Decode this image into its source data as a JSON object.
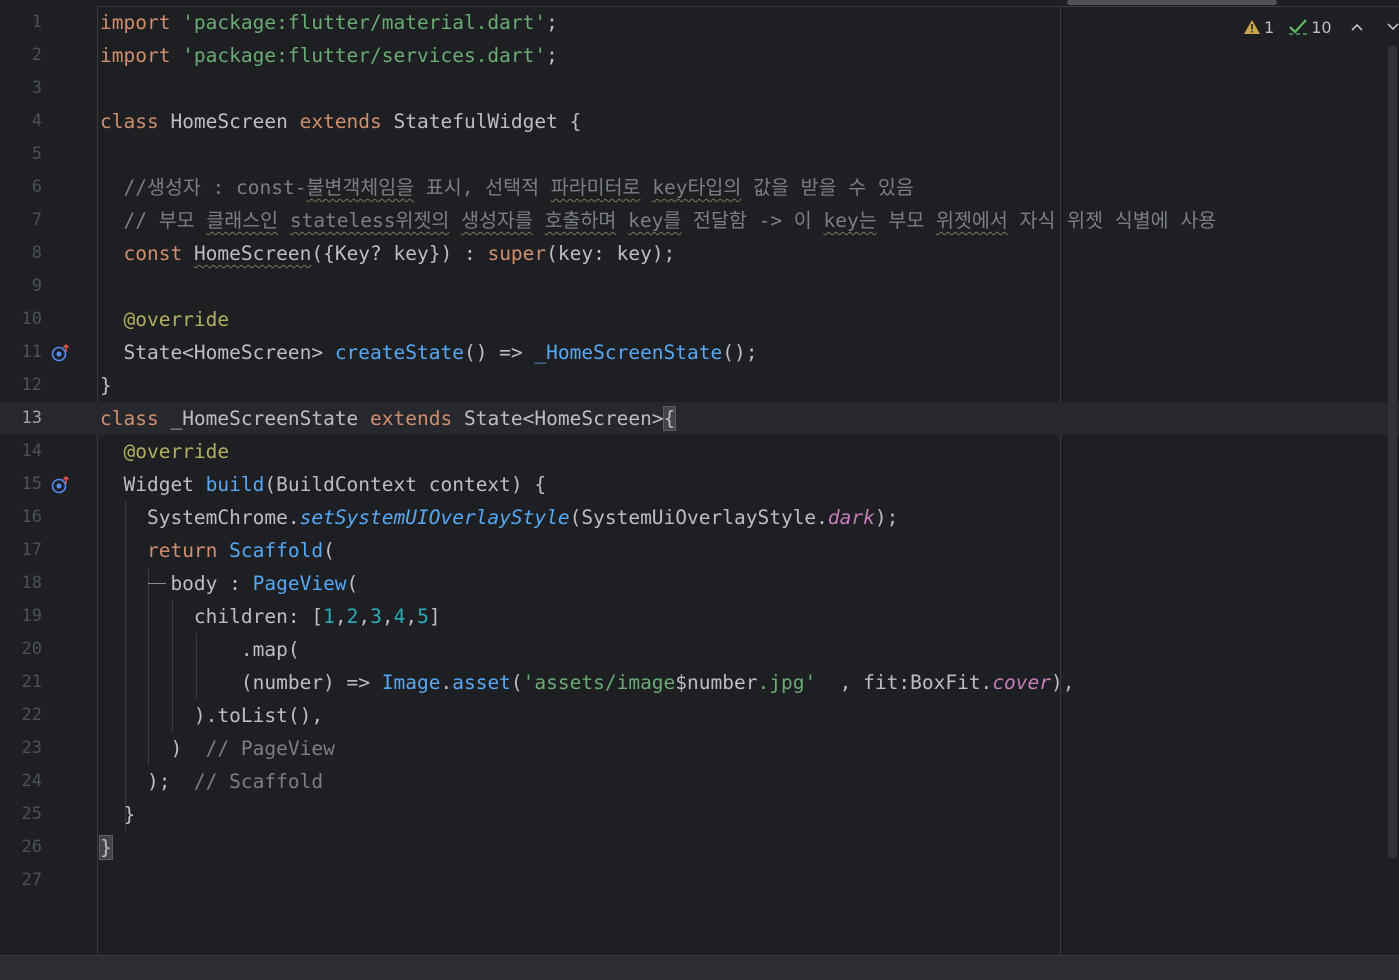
{
  "inspections": {
    "warning_icon": "warning-icon",
    "warning_count": "1",
    "check_icon": "check-icon",
    "check_count": "10",
    "prev_icon": "chevron-up-icon",
    "next_icon": "chevron-down-icon"
  },
  "colors": {
    "keyword": "#cf8e6d",
    "string": "#6aab73",
    "number": "#2aacb8",
    "function": "#56a8f5",
    "property": "#c77dbb",
    "comment": "#7a7e85",
    "annotation": "#b3ae60",
    "background": "#1e1f22"
  },
  "lines": [
    {
      "n": "1",
      "segs": [
        {
          "t": "import ",
          "c": "kw"
        },
        {
          "t": "'package:flutter/material.dart'",
          "c": "str"
        },
        {
          "t": ";"
        }
      ]
    },
    {
      "n": "2",
      "segs": [
        {
          "t": "import ",
          "c": "kw"
        },
        {
          "t": "'package:flutter/services.dart'",
          "c": "str"
        },
        {
          "t": ";"
        }
      ]
    },
    {
      "n": "3",
      "segs": []
    },
    {
      "n": "4",
      "segs": [
        {
          "t": "class ",
          "c": "kw"
        },
        {
          "t": "HomeScreen "
        },
        {
          "t": "extends ",
          "c": "kw"
        },
        {
          "t": "StatefulWidget {"
        }
      ]
    },
    {
      "n": "5",
      "segs": []
    },
    {
      "n": "6",
      "segs": [
        {
          "t": "  //생성자 : const-",
          "c": "cmt"
        },
        {
          "t": "불변객체임을",
          "c": "cmt sq"
        },
        {
          "t": " 표시, 선택적 ",
          "c": "cmt"
        },
        {
          "t": "파라미터로",
          "c": "cmt sq"
        },
        {
          "t": " ",
          "c": "cmt"
        },
        {
          "t": "key타입의",
          "c": "cmt sq"
        },
        {
          "t": " 값을 받을 수 있음",
          "c": "cmt"
        }
      ]
    },
    {
      "n": "7",
      "segs": [
        {
          "t": "  // 부모 ",
          "c": "cmt"
        },
        {
          "t": "클래스인",
          "c": "cmt sq"
        },
        {
          "t": " ",
          "c": "cmt"
        },
        {
          "t": "stateless위젯의",
          "c": "cmt sq"
        },
        {
          "t": " ",
          "c": "cmt"
        },
        {
          "t": "생성자를",
          "c": "cmt sq"
        },
        {
          "t": " ",
          "c": "cmt"
        },
        {
          "t": "호출하며",
          "c": "cmt sq"
        },
        {
          "t": " ",
          "c": "cmt"
        },
        {
          "t": "key를",
          "c": "cmt sq"
        },
        {
          "t": " 전달함 -> 이 ",
          "c": "cmt"
        },
        {
          "t": "key는",
          "c": "cmt sq"
        },
        {
          "t": " 부모 ",
          "c": "cmt"
        },
        {
          "t": "위젯에서",
          "c": "cmt sq"
        },
        {
          "t": " 자식 위젯 식별에 사용",
          "c": "cmt"
        }
      ]
    },
    {
      "n": "8",
      "segs": [
        {
          "t": "  "
        },
        {
          "t": "const ",
          "c": "kw"
        },
        {
          "t": "HomeScreen",
          "c": "sq"
        },
        {
          "t": "({Key? key}) : "
        },
        {
          "t": "super",
          "c": "kw"
        },
        {
          "t": "(key: key);"
        }
      ]
    },
    {
      "n": "9",
      "segs": []
    },
    {
      "n": "10",
      "segs": [
        {
          "t": "  "
        },
        {
          "t": "@override",
          "c": "ann"
        }
      ]
    },
    {
      "n": "11",
      "icon": true,
      "segs": [
        {
          "t": "  State<HomeScreen> "
        },
        {
          "t": "createState",
          "c": "fn"
        },
        {
          "t": "() => "
        },
        {
          "t": "_HomeScreenState",
          "c": "fn"
        },
        {
          "t": "();"
        }
      ]
    },
    {
      "n": "12",
      "segs": [
        {
          "t": "}"
        }
      ]
    },
    {
      "n": "13",
      "cur": true,
      "segs": [
        {
          "t": "class ",
          "c": "kw"
        },
        {
          "t": "_HomeScreenState "
        },
        {
          "t": "extends ",
          "c": "kw"
        },
        {
          "t": "State<HomeScreen>"
        },
        {
          "t": "{",
          "c": "brace-hl"
        }
      ]
    },
    {
      "n": "14",
      "segs": [
        {
          "t": "  "
        },
        {
          "t": "@override",
          "c": "ann"
        }
      ]
    },
    {
      "n": "15",
      "icon": true,
      "segs": [
        {
          "t": "  Widget "
        },
        {
          "t": "build",
          "c": "fn"
        },
        {
          "t": "(BuildContext context) {"
        }
      ]
    },
    {
      "n": "16",
      "segs": [
        {
          "t": "    SystemChrome."
        },
        {
          "t": "setSystemUIOverlayStyle",
          "c": "ital"
        },
        {
          "t": "(SystemUiOverlayStyle."
        },
        {
          "t": "dark",
          "c": "prop"
        },
        {
          "t": ");"
        }
      ]
    },
    {
      "n": "17",
      "segs": [
        {
          "t": "    "
        },
        {
          "t": "return ",
          "c": "kw"
        },
        {
          "t": "Scaffold",
          "c": "fn"
        },
        {
          "t": "("
        }
      ]
    },
    {
      "n": "18",
      "segs": [
        {
          "t": "      body : "
        },
        {
          "t": "PageView",
          "c": "fn"
        },
        {
          "t": "("
        }
      ]
    },
    {
      "n": "19",
      "segs": [
        {
          "t": "        children: ["
        },
        {
          "t": "1",
          "c": "num"
        },
        {
          "t": ","
        },
        {
          "t": "2",
          "c": "num"
        },
        {
          "t": ","
        },
        {
          "t": "3",
          "c": "num"
        },
        {
          "t": ","
        },
        {
          "t": "4",
          "c": "num"
        },
        {
          "t": ","
        },
        {
          "t": "5",
          "c": "num"
        },
        {
          "t": "]"
        }
      ]
    },
    {
      "n": "20",
      "segs": [
        {
          "t": "            .map("
        }
      ]
    },
    {
      "n": "21",
      "segs": [
        {
          "t": "            (number) => "
        },
        {
          "t": "Image",
          "c": "fn"
        },
        {
          "t": "."
        },
        {
          "t": "asset",
          "c": "fn"
        },
        {
          "t": "("
        },
        {
          "t": "'assets/image",
          "c": "str"
        },
        {
          "t": "$number"
        },
        {
          "t": ".jpg' ",
          "c": "str"
        },
        {
          "t": " , fit:BoxFit."
        },
        {
          "t": "cover",
          "c": "prop"
        },
        {
          "t": "),"
        }
      ]
    },
    {
      "n": "22",
      "segs": [
        {
          "t": "        ).toList(),"
        }
      ]
    },
    {
      "n": "23",
      "segs": [
        {
          "t": "      )  "
        },
        {
          "t": "// PageView",
          "c": "cmt"
        }
      ]
    },
    {
      "n": "24",
      "segs": [
        {
          "t": "    );  "
        },
        {
          "t": "// Scaffold",
          "c": "cmt"
        }
      ]
    },
    {
      "n": "25",
      "segs": [
        {
          "t": "  }"
        }
      ]
    },
    {
      "n": "26",
      "segs": [
        {
          "t": "}",
          "c": "brace-hl"
        }
      ]
    },
    {
      "n": "27",
      "segs": []
    }
  ]
}
